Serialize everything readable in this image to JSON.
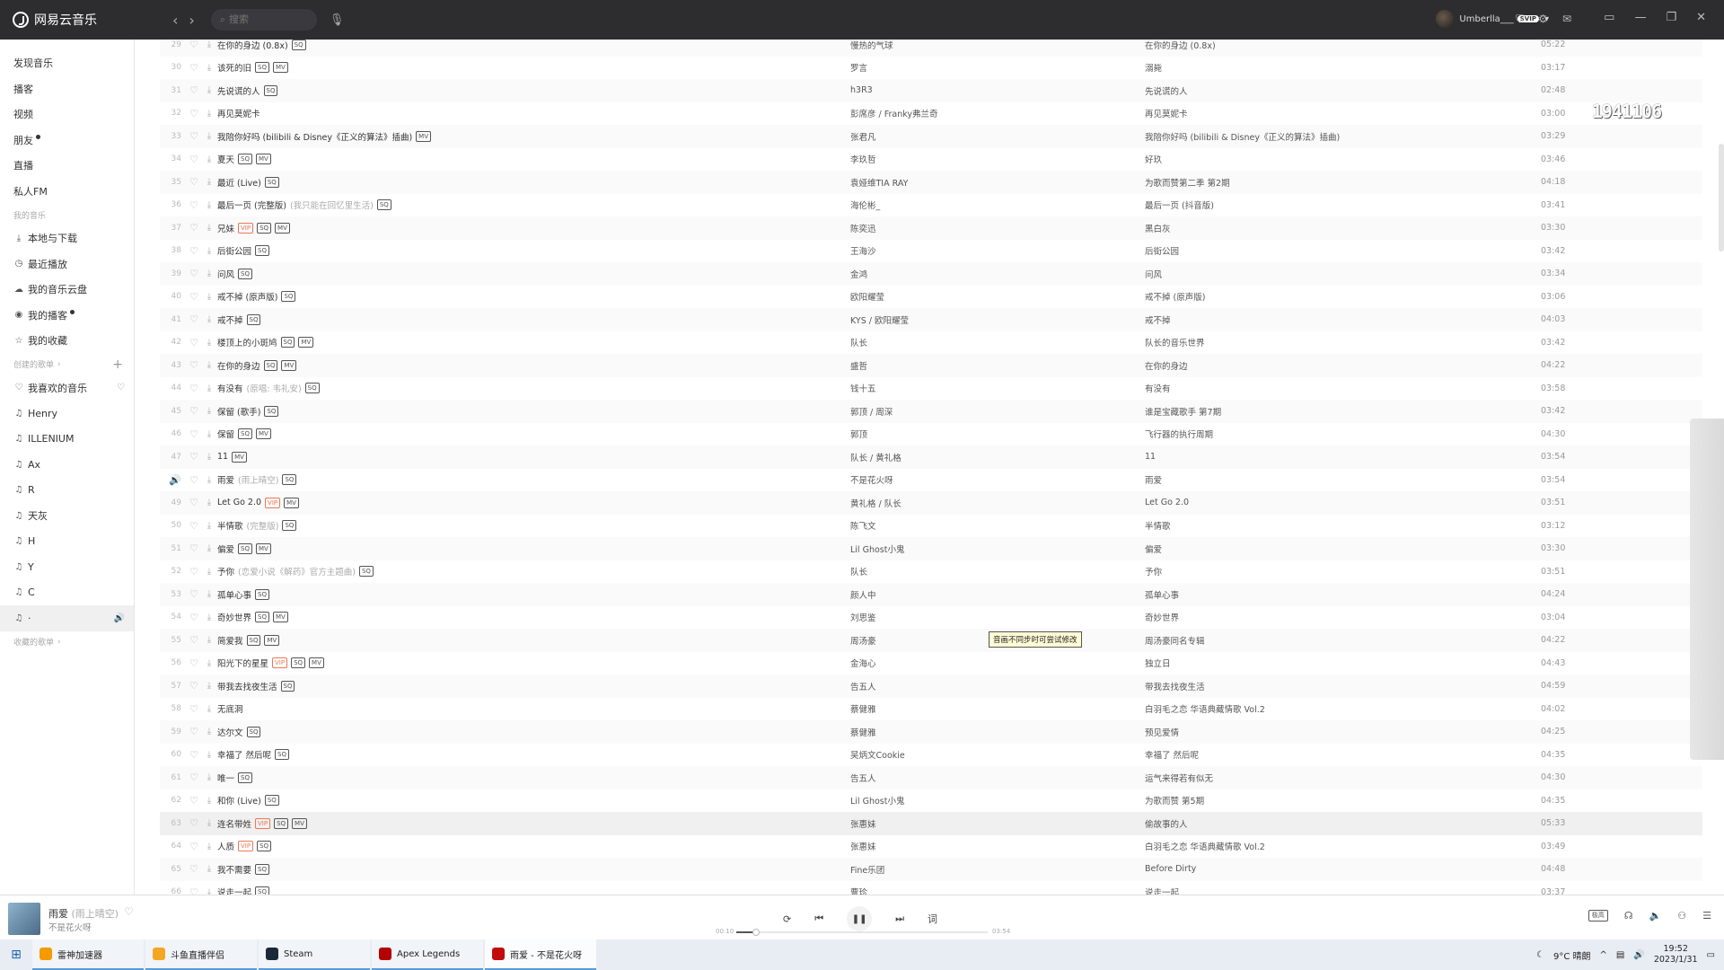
{
  "app": {
    "title": "网易云音乐",
    "search_placeholder": "搜索"
  },
  "user": {
    "name": "Umberlla___",
    "vip": "SVIP"
  },
  "sidebar": {
    "top_items": [
      {
        "label": "发现音乐",
        "dot": false
      },
      {
        "label": "播客",
        "dot": false
      },
      {
        "label": "视频",
        "dot": false
      },
      {
        "label": "朋友",
        "dot": true
      },
      {
        "label": "直播",
        "dot": false
      },
      {
        "label": "私人FM",
        "dot": false
      }
    ],
    "my_music_header": "我的音乐",
    "my_music": [
      {
        "label": "本地与下载",
        "icon": "download-icon"
      },
      {
        "label": "最近播放",
        "icon": "clock-icon"
      },
      {
        "label": "我的音乐云盘",
        "icon": "cloud-icon"
      },
      {
        "label": "我的播客",
        "icon": "podcast-icon"
      },
      {
        "label": "我的收藏",
        "icon": "star-icon"
      }
    ],
    "created_header": "创建的歌单",
    "created": [
      {
        "label": "我喜欢的音乐",
        "icon": "heart-icon"
      },
      {
        "label": "Henry",
        "icon": "playlist-icon"
      },
      {
        "label": "ILLENIUM",
        "icon": "playlist-icon"
      },
      {
        "label": "Ax",
        "icon": "playlist-icon"
      },
      {
        "label": "R",
        "icon": "playlist-icon"
      },
      {
        "label": "天灰",
        "icon": "playlist-icon"
      },
      {
        "label": "H",
        "icon": "playlist-icon"
      },
      {
        "label": "Y",
        "icon": "playlist-icon"
      },
      {
        "label": "C",
        "icon": "playlist-icon"
      },
      {
        "label": "·",
        "icon": "playlist-icon"
      }
    ],
    "collected_header": "收藏的歌单"
  },
  "songs": [
    {
      "n": "29",
      "title": "在你的身边 (0.8x)",
      "sub": "",
      "tags": [
        "SQ"
      ],
      "artist": "慢热的气球",
      "album": "在你的身边 (0.8x)",
      "dur": "05:22"
    },
    {
      "n": "30",
      "title": "该死的旧",
      "sub": "",
      "tags": [
        "SQ",
        "MV"
      ],
      "artist": "罗言",
      "album": "溺毙",
      "dur": "03:17"
    },
    {
      "n": "31",
      "title": "先说谎的人",
      "sub": "",
      "tags": [
        "SQ"
      ],
      "artist": "h3R3",
      "album": "先说谎的人",
      "dur": "02:48"
    },
    {
      "n": "32",
      "title": "再见莫妮卡",
      "sub": "",
      "tags": [],
      "artist": "彭席彦 / Franky弗兰奇",
      "album": "再见莫妮卡",
      "dur": "03:00"
    },
    {
      "n": "33",
      "title": "我陪你好吗 (bilibili & Disney《正义的算法》插曲)",
      "sub": "",
      "tags": [
        "MV"
      ],
      "artist": "张君凡",
      "album": "我陪你好吗 (bilibili & Disney《正义的算法》插曲)",
      "dur": "03:29"
    },
    {
      "n": "34",
      "title": "夏天",
      "sub": "",
      "tags": [
        "SQ",
        "MV"
      ],
      "artist": "李玖哲",
      "album": "好玖",
      "dur": "03:46"
    },
    {
      "n": "35",
      "title": "最近 (Live)",
      "sub": "",
      "tags": [
        "SQ"
      ],
      "artist": "袁娅维TIA RAY",
      "album": "为歌而赞第二季 第2期",
      "dur": "04:18"
    },
    {
      "n": "36",
      "title": "最后一页 (完整版)",
      "sub": "(我只能在回忆里生活)",
      "tags": [
        "SQ"
      ],
      "artist": "海伦彬_",
      "album": "最后一页 (抖音版)",
      "dur": "03:41"
    },
    {
      "n": "37",
      "title": "兄妹",
      "sub": "",
      "tags": [
        "VIP",
        "SQ",
        "MV"
      ],
      "artist": "陈奕迅",
      "album": "黑白灰",
      "dur": "03:30"
    },
    {
      "n": "38",
      "title": "后街公园",
      "sub": "",
      "tags": [
        "SQ"
      ],
      "artist": "王海沙",
      "album": "后街公园",
      "dur": "03:42"
    },
    {
      "n": "39",
      "title": "问风",
      "sub": "",
      "tags": [
        "SQ"
      ],
      "artist": "金鸿",
      "album": "问风",
      "dur": "03:34"
    },
    {
      "n": "40",
      "title": "戒不掉 (原声版)",
      "sub": "",
      "tags": [
        "SQ"
      ],
      "artist": "欧阳耀莹",
      "album": "戒不掉 (原声版)",
      "dur": "03:06"
    },
    {
      "n": "41",
      "title": "戒不掉",
      "sub": "",
      "tags": [
        "SQ"
      ],
      "artist": "KYS / 欧阳耀莹",
      "album": "戒不掉",
      "dur": "04:03"
    },
    {
      "n": "42",
      "title": "楼顶上的小斑鸠",
      "sub": "",
      "tags": [
        "SQ",
        "MV"
      ],
      "artist": "队长",
      "album": "队长的音乐世界",
      "dur": "03:42"
    },
    {
      "n": "43",
      "title": "在你的身边",
      "sub": "",
      "tags": [
        "SQ",
        "MV"
      ],
      "artist": "盛哲",
      "album": "在你的身边",
      "dur": "04:22"
    },
    {
      "n": "44",
      "title": "有没有",
      "sub": "(原唱: 韦礼安)",
      "tags": [
        "SQ"
      ],
      "artist": "钱十五",
      "album": "有没有",
      "dur": "03:58"
    },
    {
      "n": "45",
      "title": "保留 (歌手)",
      "sub": "",
      "tags": [
        "SQ"
      ],
      "artist": "郭顶 / 周深",
      "album": "谁是宝藏歌手 第7期",
      "dur": "03:42"
    },
    {
      "n": "46",
      "title": "保留",
      "sub": "",
      "tags": [
        "SQ",
        "MV"
      ],
      "artist": "郭顶",
      "album": "飞行器的执行周期",
      "dur": "04:30"
    },
    {
      "n": "47",
      "title": "11",
      "sub": "",
      "tags": [
        "MV"
      ],
      "artist": "队长 / 黄礼格",
      "album": "11",
      "dur": "03:54"
    },
    {
      "n": "48",
      "title": "雨爱",
      "sub": "(雨上晴空)",
      "tags": [
        "SQ"
      ],
      "artist": "不是花火呀",
      "album": "雨爱",
      "dur": "03:54",
      "playing": true
    },
    {
      "n": "49",
      "title": "Let Go 2.0",
      "sub": "",
      "tags": [
        "VIP",
        "MV"
      ],
      "artist": "黄礼格 / 队长",
      "album": "Let Go 2.0",
      "dur": "03:51"
    },
    {
      "n": "50",
      "title": "半情歌",
      "sub": "(完整版)",
      "tags": [
        "SQ"
      ],
      "artist": "陈飞文",
      "album": "半情歌",
      "dur": "03:12"
    },
    {
      "n": "51",
      "title": "偏爱",
      "sub": "",
      "tags": [
        "SQ",
        "MV"
      ],
      "artist": "Lil Ghost小鬼",
      "album": "偏爱",
      "dur": "03:30"
    },
    {
      "n": "52",
      "title": "予你",
      "sub": "(恋爱小说《解药》官方主题曲)",
      "tags": [
        "SQ"
      ],
      "artist": "队长",
      "album": "予你",
      "dur": "03:51"
    },
    {
      "n": "53",
      "title": "孤单心事",
      "sub": "",
      "tags": [
        "SQ"
      ],
      "artist": "颜人中",
      "album": "孤单心事",
      "dur": "04:24"
    },
    {
      "n": "54",
      "title": "奇妙世界",
      "sub": "",
      "tags": [
        "SQ",
        "MV"
      ],
      "artist": "刘思鉴",
      "album": "奇妙世界",
      "dur": "03:04"
    },
    {
      "n": "55",
      "title": "简爱我",
      "sub": "",
      "tags": [
        "SQ",
        "MV"
      ],
      "artist": "周汤豪",
      "album": "周汤豪同名专辑",
      "dur": "04:22"
    },
    {
      "n": "56",
      "title": "阳光下的星星",
      "sub": "",
      "tags": [
        "VIP",
        "SQ",
        "MV"
      ],
      "artist": "金海心",
      "album": "独立日",
      "dur": "04:43"
    },
    {
      "n": "57",
      "title": "带我去找夜生活",
      "sub": "",
      "tags": [
        "SQ"
      ],
      "artist": "告五人",
      "album": "带我去找夜生活",
      "dur": "04:59"
    },
    {
      "n": "58",
      "title": "无底洞",
      "sub": "",
      "tags": [],
      "artist": "蔡健雅",
      "album": "白羽毛之恋 华语典藏情歌 Vol.2",
      "dur": "04:02"
    },
    {
      "n": "59",
      "title": "达尔文",
      "sub": "",
      "tags": [
        "SQ"
      ],
      "artist": "蔡健雅",
      "album": "预见爱情",
      "dur": "04:25"
    },
    {
      "n": "60",
      "title": "幸福了 然后呢",
      "sub": "",
      "tags": [
        "SQ"
      ],
      "artist": "吴炳文Cookie",
      "album": "幸福了 然后呢",
      "dur": "04:35"
    },
    {
      "n": "61",
      "title": "唯一",
      "sub": "",
      "tags": [
        "SQ"
      ],
      "artist": "告五人",
      "album": "运气来得若有似无",
      "dur": "04:30"
    },
    {
      "n": "62",
      "title": "和你 (Live)",
      "sub": "",
      "tags": [
        "SQ"
      ],
      "artist": "Lil Ghost小鬼",
      "album": "为歌而赞 第5期",
      "dur": "04:35"
    },
    {
      "n": "63",
      "title": "连名带姓",
      "sub": "",
      "tags": [
        "VIP",
        "SQ",
        "MV"
      ],
      "artist": "张惠妹",
      "album": "偷故事的人",
      "dur": "05:33",
      "hl": true
    },
    {
      "n": "64",
      "title": "人质",
      "sub": "",
      "tags": [
        "VIP",
        "SQ"
      ],
      "artist": "张惠妹",
      "album": "白羽毛之恋 华语典藏情歌 Vol.2",
      "dur": "03:49"
    },
    {
      "n": "65",
      "title": "我不需要",
      "sub": "",
      "tags": [
        "SQ"
      ],
      "artist": "Fine乐团",
      "album": "Before Dirty",
      "dur": "04:48"
    },
    {
      "n": "66",
      "title": "说走一起",
      "sub": "",
      "tags": [
        "SQ"
      ],
      "artist": "曹珍",
      "album": "说走一起",
      "dur": "03:37"
    }
  ],
  "tooltip": "音画不同步时可尝试修改",
  "watermark": "1941106",
  "player": {
    "title": "雨爱",
    "sub": "(雨上晴空)",
    "artist": "不是花火呀",
    "time_current": "00:10",
    "time_total": "03:54",
    "progress": 0.08,
    "quality": "极高",
    "lyric_btn": "词"
  },
  "taskbar": {
    "apps": [
      {
        "label": "雷神加速器",
        "color": "#f59a00"
      },
      {
        "label": "斗鱼直播伴侣",
        "color": "#f5a623"
      },
      {
        "label": "Steam",
        "color": "#1b2838"
      },
      {
        "label": "Apex Legends",
        "color": "#b30000"
      },
      {
        "label": "雨爱 - 不是花火呀",
        "color": "#c20c0c"
      }
    ],
    "weather": "9°C 晴朗",
    "time": "19:52",
    "date": "2023/1/31"
  }
}
